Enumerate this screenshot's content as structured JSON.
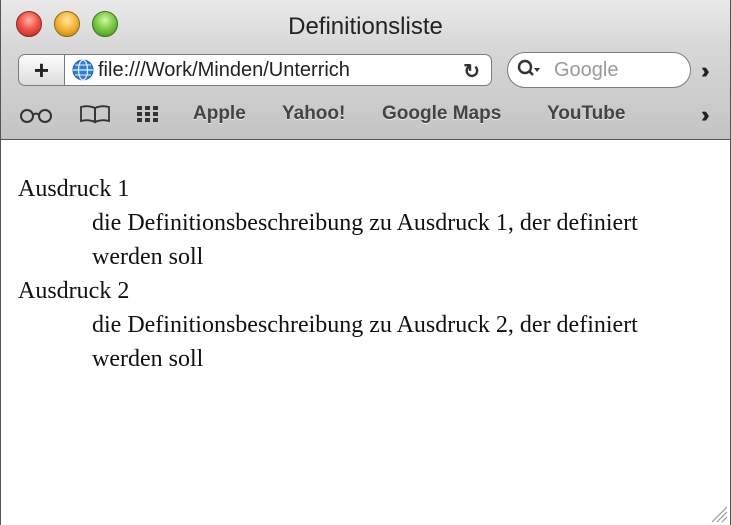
{
  "window": {
    "title": "Definitionsliste"
  },
  "toolbar": {
    "add_label": "+",
    "url": "file:///Work/Minden/Unterrich",
    "reload_glyph": "↻",
    "search_placeholder": "Google",
    "overflow_glyph": "››"
  },
  "bookmarks": {
    "icons": [
      "reading-glasses-icon",
      "book-icon",
      "grid-icon"
    ],
    "items": [
      {
        "label": "Apple"
      },
      {
        "label": "Yahoo!"
      },
      {
        "label": "Google Maps"
      },
      {
        "label": "YouTube"
      }
    ]
  },
  "content": {
    "definitions": [
      {
        "term": "Ausdruck 1",
        "description": "die Definitionsbeschreibung zu Ausdruck 1, der definiert werden soll"
      },
      {
        "term": "Ausdruck 2",
        "description": "die Definitionsbeschreibung zu Ausdruck 2, der definiert werden soll"
      }
    ]
  },
  "colors": {
    "close": "#f0564a",
    "minimize": "#f5b73a",
    "zoom": "#7ccc45",
    "globe": "#2f7fd8"
  }
}
